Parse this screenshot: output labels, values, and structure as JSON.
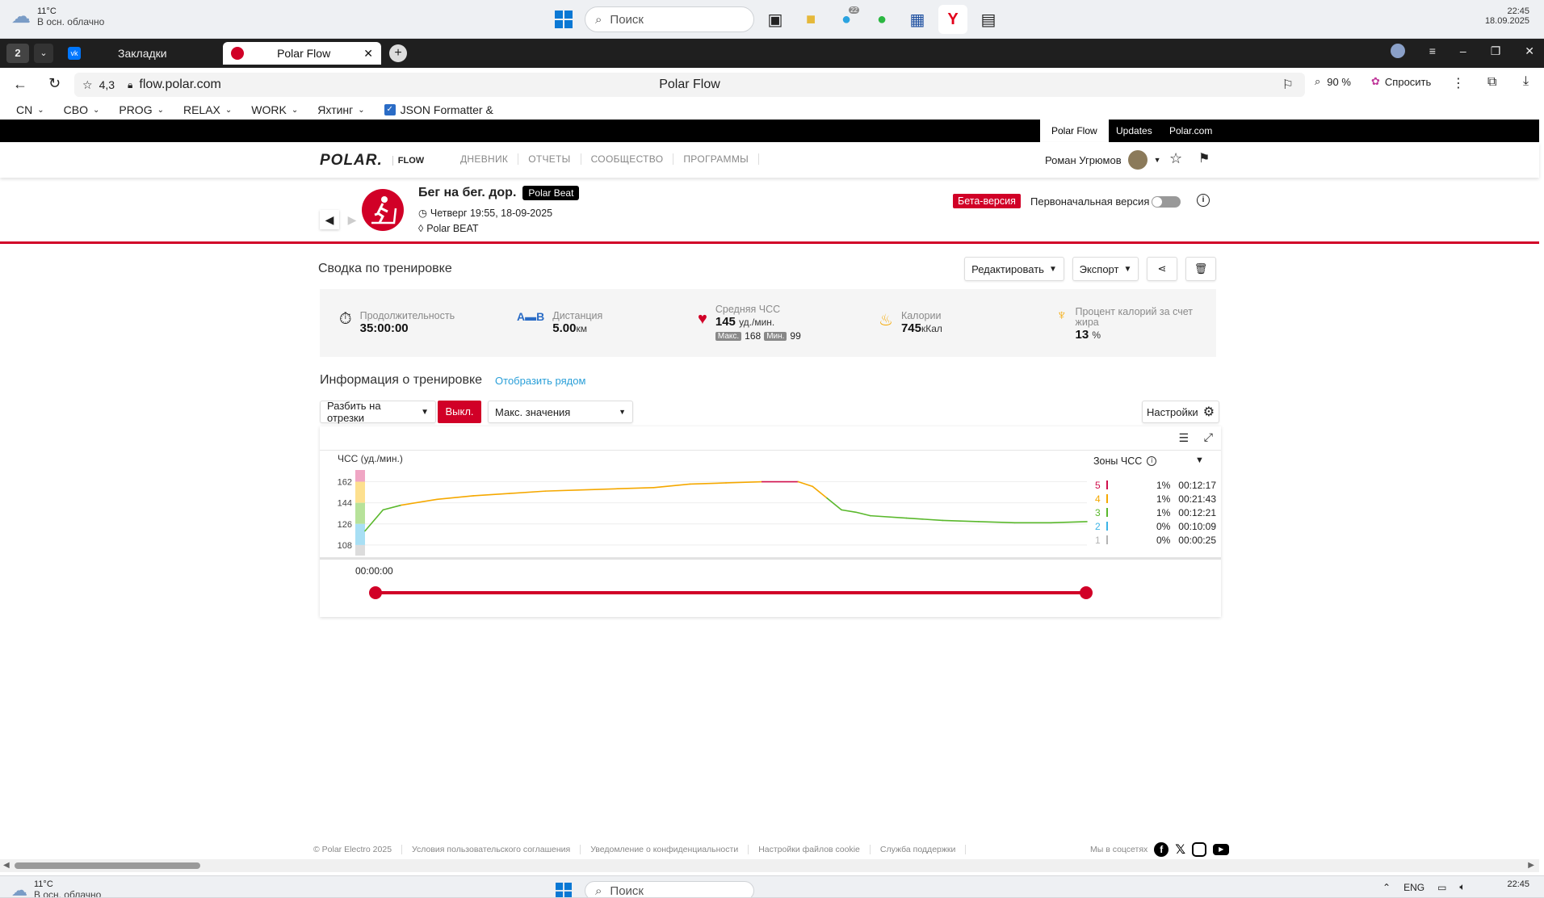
{
  "os": {
    "weather_temp": "11°C",
    "weather_desc": "В осн. облачно",
    "search_placeholder": "Поиск",
    "clock_time": "22:45",
    "clock_date": "18.09.2025",
    "telegram_badge": "22",
    "lang": "ENG"
  },
  "browser": {
    "tab_count": "2",
    "tabs": [
      {
        "label": "Закладки"
      },
      {
        "label": "Polar Flow"
      }
    ],
    "rating": "4,3",
    "url": "flow.polar.com",
    "page_title": "Polar Flow",
    "zoom": "90 %",
    "ask_label": "Спросить",
    "bookmarks": [
      {
        "label": "CN"
      },
      {
        "label": "CBO"
      },
      {
        "label": "PROG"
      },
      {
        "label": "RELAX"
      },
      {
        "label": "WORK"
      },
      {
        "label": "Яхтинг"
      }
    ],
    "bookmark_json": "JSON Formatter &"
  },
  "site": {
    "top_links": [
      "Polar Flow",
      "Updates",
      "Polar.com"
    ],
    "logo": "POLAR.",
    "logo_sub": "FLOW",
    "nav": [
      "ДНЕВНИК",
      "ОТЧЕТЫ",
      "СООБЩЕСТВО",
      "ПРОГРАММЫ"
    ],
    "user_name": "Роман Угрюмов"
  },
  "session": {
    "title": "Бег на бег. дор.",
    "device_badge": "Polar Beat",
    "datetime": "Четверг 19:55, 18-09-2025",
    "device": "Polar BEAT",
    "beta_label": "Бета-версия",
    "original_label": "Первоначальная версия"
  },
  "summary": {
    "heading": "Сводка по тренировке",
    "edit_label": "Редактировать",
    "export_label": "Экспорт",
    "duration_label": "Продолжительность",
    "duration_value": "35:00:00",
    "distance_label": "Дистанция",
    "distance_value": "5.00",
    "distance_unit": "км",
    "hr_label": "Средняя ЧСС",
    "hr_value": "145",
    "hr_unit": "уд./мин.",
    "hr_max_label": "Макс.",
    "hr_max": "168",
    "hr_min_label": "Мин.",
    "hr_min": "99",
    "cal_label": "Калории",
    "cal_value": "745",
    "cal_unit": "кКал",
    "fat_label": "Процент калорий за счет жира",
    "fat_value": "13",
    "fat_unit": "%"
  },
  "info": {
    "heading": "Информация о тренировке",
    "side_by_side": "Отобразить рядом",
    "split_label": "Разбить на отрезки",
    "off_label": "Выкл.",
    "max_values": "Макс. значения",
    "settings_label": "Настройки",
    "time_label": "00:00:00"
  },
  "chart_data": {
    "type": "line",
    "ylabel": "ЧСС (уд./мин.)",
    "y_ticks": [
      108,
      126,
      144,
      162
    ],
    "ylim": [
      99,
      172
    ],
    "x": [
      0,
      0.025,
      0.05,
      0.1,
      0.15,
      0.2,
      0.25,
      0.3,
      0.35,
      0.4,
      0.45,
      0.5,
      0.55,
      0.6,
      0.62,
      0.64,
      0.66,
      0.68,
      0.7,
      0.75,
      0.8,
      0.85,
      0.9,
      0.95,
      1.0
    ],
    "values": [
      120,
      138,
      142,
      147,
      150,
      152,
      154,
      155,
      156,
      157,
      160,
      161,
      162,
      162,
      158,
      148,
      138,
      136,
      133,
      131,
      129,
      128,
      127,
      127,
      128
    ],
    "zone_colors": {
      "5": "#d0104c",
      "4": "#f5a800",
      "3": "#5ab82c",
      "2": "#3cb4e6",
      "1": "#b4b4b4"
    },
    "zones_title": "Зоны ЧСС",
    "zones": [
      {
        "zone": "5",
        "pct": "1%",
        "time": "00:12:17"
      },
      {
        "zone": "4",
        "pct": "1%",
        "time": "00:21:43"
      },
      {
        "zone": "3",
        "pct": "1%",
        "time": "00:12:21"
      },
      {
        "zone": "2",
        "pct": "0%",
        "time": "00:10:09"
      },
      {
        "zone": "1",
        "pct": "0%",
        "time": "00:00:25"
      }
    ]
  },
  "footer": {
    "copyright": "© Polar Electro 2025",
    "links": [
      "Условия пользовательского соглашения",
      "Уведомление о конфиденциальности",
      "Настройки файлов cookie",
      "Служба поддержки"
    ],
    "social_label": "Мы в соцсетях"
  }
}
